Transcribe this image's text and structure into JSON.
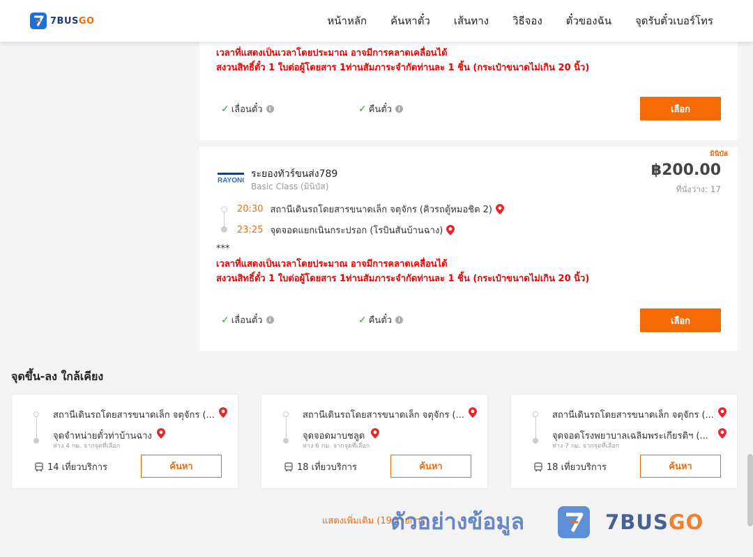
{
  "header": {
    "logo_a": "7BUS",
    "logo_b": "GO",
    "nav": [
      "หน้าหลัก",
      "ค้นหาตั๋ว",
      "เส้นทาง",
      "วิธีจอง",
      "ตั๋วของฉัน",
      "จุดรับตั๋วเบอร์โทร"
    ]
  },
  "trip1": {
    "notice_line1": "เวลาที่แสดงเป็นเวลาโดยประมาณ อาจมีการคลาดเคลื่อนได้",
    "notice_line2": "สงวนสิทธิ์ตั๋ว 1 ใบต่อผู้โดยสาร 1ท่านสัมภาระจำกัดท่านละ 1 ชิ้น (กระเป๋าขนาดไม่เกิน 20 นิ้ว)",
    "feature1": "เลื่อนตั๋ว",
    "feature2": "คืนตั๋ว",
    "select_label": "เลือก"
  },
  "trip2": {
    "badge": "มินิบัส",
    "operator_logo_text": "RAYONG",
    "operator": "ระยองทัวร์ขนส่ง789",
    "class": "Basic Class (มินิบัส)",
    "price": "฿200.00",
    "seats": "ที่นั่งว่าง: 17",
    "depart_time": "20:30",
    "depart_place": "สถานีเดินรถโดยสารขนาดเล็ก จตุจักร (คิวรถตู้หมอชิต 2)",
    "arrive_time": "23:25",
    "arrive_place": "จุดจอดแยกเนินกระปรอก (โรบินสันบ้านฉาง)",
    "stars": "***",
    "notice_line1": "เวลาที่แสดงเป็นเวลาโดยประมาณ อาจมีการคลาดเคลื่อนได้",
    "notice_line2": "สงวนสิทธิ์ตั๋ว 1 ใบต่อผู้โดยสาร 1ท่านสัมภาระจำกัดท่านละ 1 ชิ้น (กระเป๋าขนาดไม่เกิน 20 นิ้ว)",
    "feature1": "เลื่อนตั๋ว",
    "feature2": "คืนตั๋ว",
    "select_label": "เลือก"
  },
  "nearby": {
    "title": "จุดขึ้น-ลง ใกล้เคียง",
    "cards": [
      {
        "from": "สถานีเดินรถโดยสารขนาดเล็ก จตุจักร (...",
        "to": "จุดจำหน่ายตั๋วท่าบ้านฉาง",
        "dist": "ห่าง 4 กม. จากจุดที่เลือก",
        "trips": "14 เที่ยวบริการ",
        "btn": "ค้นหา"
      },
      {
        "from": "สถานีเดินรถโดยสารขนาดเล็ก จตุจักร (...",
        "to": "จุดจอดมาบชลูด",
        "dist": "ห่าง 6 กม. จากจุดที่เลือก",
        "trips": "18 เที่ยวบริการ",
        "btn": "ค้นหา"
      },
      {
        "from": "สถานีเดินรถโดยสารขนาดเล็ก จตุจักร (...",
        "to": "จุดจอดโรงพยาบาลเฉลิมพระเกียรติฯ (...",
        "dist": "ห่าง 7 กม. จากจุดที่เลือก",
        "trips": "18 เที่ยวบริการ",
        "btn": "ค้นหา"
      }
    ],
    "show_more": "แสดงเพิ่มเติม (19 รายการ)"
  },
  "watermark": {
    "text": "ตัวอย่างข้อมูล",
    "brand_a": "7BUS",
    "brand_b": "GO"
  },
  "colors": {
    "accent": "#f76b05",
    "brand_blue": "#1e6fd9",
    "notice_red": "#e00000",
    "check_green": "#2aa03c"
  }
}
